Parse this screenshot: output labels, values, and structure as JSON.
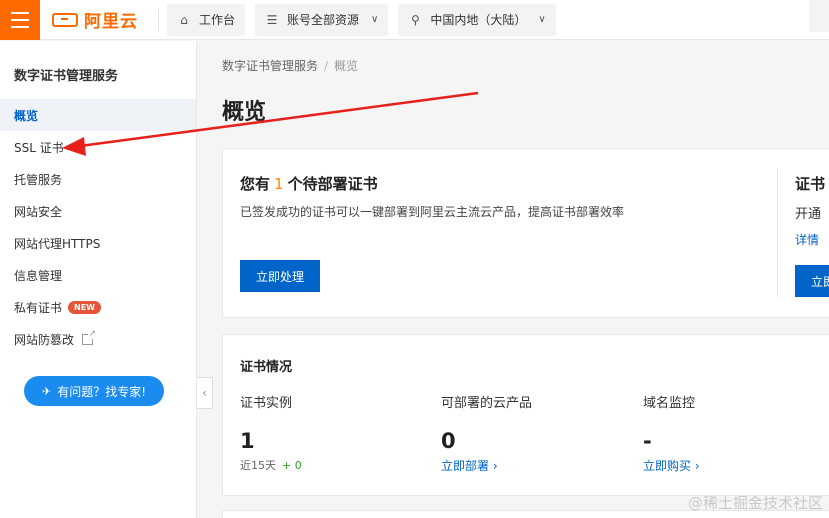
{
  "topbar": {
    "logo_text": "阿里云",
    "workbench": "工作台",
    "resources": "账号全部资源",
    "region": "中国内地（大陆）",
    "colors": {
      "brand": "#ff6a00"
    }
  },
  "sidebar": {
    "title": "数字证书管理服务",
    "items": [
      {
        "label": "概览",
        "active": true
      },
      {
        "label": "SSL 证书"
      },
      {
        "label": "托管服务"
      },
      {
        "label": "网站安全"
      },
      {
        "label": "网站代理HTTPS"
      },
      {
        "label": "信息管理"
      },
      {
        "label": "私有证书",
        "badge": "NEW"
      },
      {
        "label": "网站防篡改",
        "external": true
      }
    ],
    "expert_button": "有问题？找专家!"
  },
  "main": {
    "breadcrumb": [
      "数字证书管理服务",
      "概览"
    ],
    "title": "概览",
    "pending_card": {
      "title_prefix": "您有",
      "count": "1",
      "title_suffix": "个待部署证书",
      "desc": "已签发成功的证书可以一键部署到阿里云主流云产品，提高证书部署效率",
      "button": "立即处理",
      "right_title": "证书",
      "right_desc": "开通",
      "right_link": "详情",
      "right_button": "立即"
    },
    "status_card": {
      "title": "证书情况",
      "stats": [
        {
          "label": "证书实例",
          "value": "1",
          "sub": "近15天",
          "delta": "+ 0"
        },
        {
          "label": "可部署的云产品",
          "value": "0",
          "link": "立即部署"
        },
        {
          "label": "域名监控",
          "value": "-",
          "link": "立即购买"
        }
      ]
    }
  },
  "watermark": "@稀土掘金技术社区"
}
